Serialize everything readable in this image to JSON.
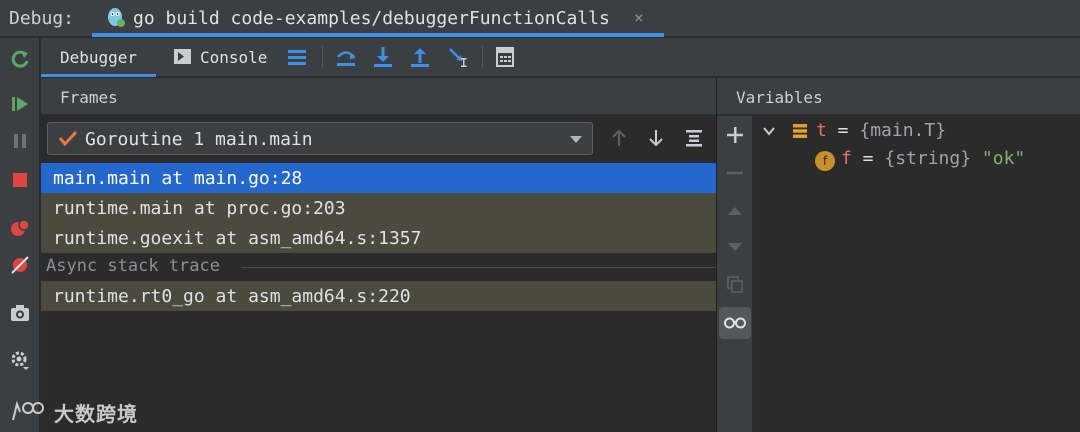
{
  "titlebar": {
    "label": "Debug:",
    "tab_title": "go build code-examples/debuggerFunctionCalls",
    "close_glyph": "×"
  },
  "tabs": {
    "debugger": "Debugger",
    "console": "Console"
  },
  "frames": {
    "header": "Frames",
    "goroutine": "Goroutine 1 main.main",
    "rows": [
      "main.main at main.go:28",
      "runtime.main at proc.go:203",
      "runtime.goexit at asm_amd64.s:1357"
    ],
    "async_label": "Async stack trace",
    "async_rows": [
      "runtime.rt0_go at asm_amd64.s:220"
    ]
  },
  "variables": {
    "header": "Variables",
    "items": [
      {
        "name": "t",
        "eq": " = ",
        "type": "{main.T}",
        "value": ""
      },
      {
        "name": "f",
        "eq": " = ",
        "type": "{string} ",
        "value": "\"ok\"",
        "field_badge": "f"
      }
    ]
  },
  "watermark": {
    "logo_text": "大数跨境"
  },
  "icons": {
    "left_toolbar": [
      "rerun-icon",
      "resume-icon",
      "pause-icon",
      "stop-icon",
      "view-breakpoints-icon",
      "mute-breakpoints-icon",
      "camera-icon",
      "settings-icon"
    ],
    "top_toolbar": [
      "layout-icon",
      "step-over-icon",
      "step-into-icon",
      "step-out-icon",
      "run-to-cursor-icon",
      "evaluate-expression-icon"
    ],
    "vars_toolbar": [
      "add-icon",
      "remove-icon",
      "up-icon",
      "down-icon",
      "copy-icon",
      "glasses-icon"
    ]
  },
  "colors": {
    "accent": "#3d8fe8",
    "selected_row": "#2468cf",
    "frame_row": "#4a4a3e",
    "var_name": "#ef6c6c",
    "string_value": "#7bb56c"
  }
}
